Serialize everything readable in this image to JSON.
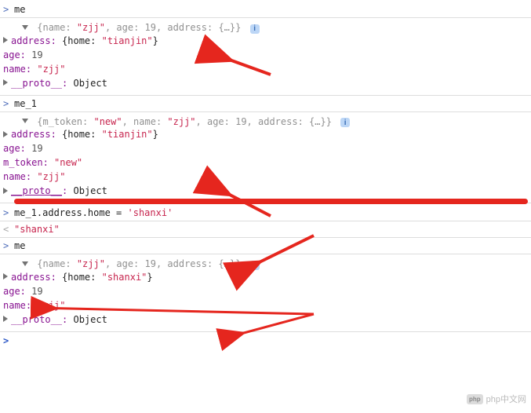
{
  "console": {
    "block1": {
      "input": "me",
      "summary": {
        "full": "{name: \"zjj\", age: 19, address: {…}}"
      },
      "props": {
        "address_label": "address:",
        "address_val": "{home: \"tianjin\"}",
        "age_label": "age:",
        "age_val": "19",
        "name_label": "name:",
        "name_val": "\"zjj\"",
        "proto_label": "__proto__:",
        "proto_val": "Object"
      }
    },
    "block2": {
      "input": "me_1",
      "summary": {
        "full": "{m_token: \"new\", name: \"zjj\", age: 19, address: {…}}"
      },
      "props": {
        "address_label": "address:",
        "address_val": "{home: \"tianjin\"}",
        "age_label": "age:",
        "age_val": "19",
        "mtoken_label": "m_token:",
        "mtoken_val": "\"new\"",
        "name_label": "name:",
        "name_val": "\"zjj\"",
        "proto_label": "__proto__:",
        "proto_val": "Object"
      }
    },
    "assign": {
      "input": "me_1.address.home = 'shanxi'",
      "output": "\"shanxi\""
    },
    "block3": {
      "input": "me",
      "summary": {
        "full": "{name: \"zjj\", age: 19, address: {…}}"
      },
      "props": {
        "address_label": "address:",
        "address_val": "{home: \"shanxi\"}",
        "age_label": "age:",
        "age_val": "19",
        "name_label": "name:",
        "name_val": "\"zjj\"",
        "proto_label": "__proto__:",
        "proto_val": "Object"
      }
    },
    "prompt": ">",
    "output_prompt": "<",
    "info": "i"
  },
  "watermark": {
    "logo": "php",
    "text": "php中文网"
  }
}
